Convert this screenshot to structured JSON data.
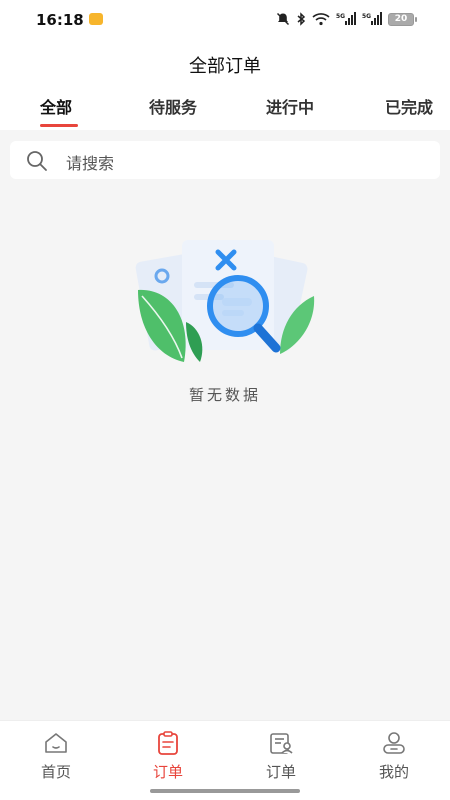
{
  "status_bar": {
    "time": "16:18",
    "battery": "20",
    "icons": [
      "mute-bell-icon",
      "bluetooth-icon",
      "wifi-icon",
      "5g-signal-icon",
      "5g-signal-icon",
      "battery-icon"
    ]
  },
  "header": {
    "title": "全部订单",
    "tabs": [
      {
        "label": "全部",
        "active": true
      },
      {
        "label": "待服务",
        "active": false
      },
      {
        "label": "进行中",
        "active": false
      },
      {
        "label": "已完成",
        "active": false
      }
    ]
  },
  "search": {
    "placeholder": "请搜索",
    "icon": "search-icon"
  },
  "empty_state": {
    "message": "暂无数据",
    "illustration": "empty-search-illustration"
  },
  "tabbar": {
    "items": [
      {
        "label": "首页",
        "icon": "home-icon",
        "active": false
      },
      {
        "label": "订单",
        "icon": "clipboard-icon",
        "active": true
      },
      {
        "label": "订单",
        "icon": "order-list-icon",
        "active": false
      },
      {
        "label": "我的",
        "icon": "user-icon",
        "active": false
      }
    ]
  },
  "colors": {
    "accent": "#e8453c",
    "background": "#f5f5f5",
    "illustration_blue": "#2f8ef0",
    "illustration_green": "#3fae5c"
  }
}
